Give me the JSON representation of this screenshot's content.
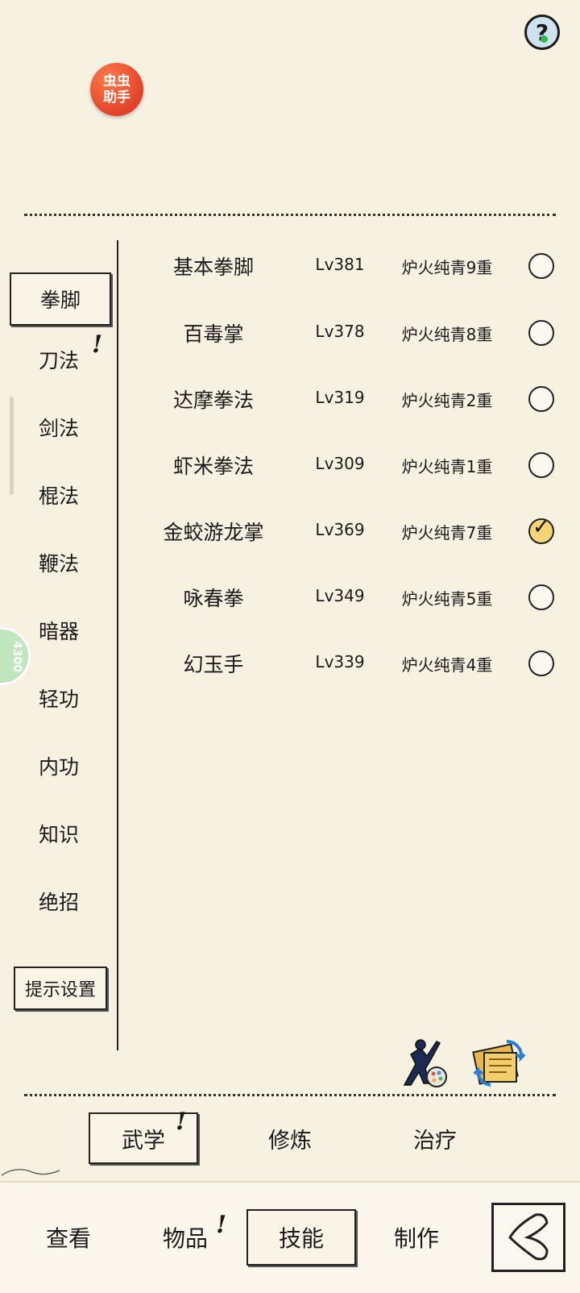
{
  "header": {
    "help_icon": "question-icon",
    "helper_badge": [
      "虫虫",
      "助手"
    ],
    "float_badge_text": "4300"
  },
  "categories": [
    {
      "label": "拳脚",
      "selected": true,
      "alert": false
    },
    {
      "label": "刀法",
      "selected": false,
      "alert": true
    },
    {
      "label": "剑法",
      "selected": false,
      "alert": false
    },
    {
      "label": "棍法",
      "selected": false,
      "alert": false
    },
    {
      "label": "鞭法",
      "selected": false,
      "alert": false
    },
    {
      "label": "暗器",
      "selected": false,
      "alert": false
    },
    {
      "label": "轻功",
      "selected": false,
      "alert": false
    },
    {
      "label": "内功",
      "selected": false,
      "alert": false
    },
    {
      "label": "知识",
      "selected": false,
      "alert": false
    },
    {
      "label": "绝招",
      "selected": false,
      "alert": false
    }
  ],
  "tip_settings_label": "提示设置",
  "skills": [
    {
      "name": "基本拳脚",
      "level": "Lv381",
      "realm": "炉火纯青9重",
      "equipped": false
    },
    {
      "name": "百毒掌",
      "level": "Lv378",
      "realm": "炉火纯青8重",
      "equipped": false
    },
    {
      "name": "达摩拳法",
      "level": "Lv319",
      "realm": "炉火纯青2重",
      "equipped": false
    },
    {
      "name": "虾米拳法",
      "level": "Lv309",
      "realm": "炉火纯青1重",
      "equipped": false
    },
    {
      "name": "金蛟游龙掌",
      "level": "Lv369",
      "realm": "炉火纯青7重",
      "equipped": true
    },
    {
      "name": "咏春拳",
      "level": "Lv349",
      "realm": "炉火纯青5重",
      "equipped": false
    },
    {
      "name": "幻玉手",
      "level": "Lv339",
      "realm": "炉火纯青4重",
      "equipped": false
    }
  ],
  "action_icons": [
    "martial-artist-icon",
    "scroll-swap-icon"
  ],
  "sub_tabs": [
    {
      "label": "武学",
      "selected": true,
      "alert": true
    },
    {
      "label": "修炼",
      "selected": false,
      "alert": false
    },
    {
      "label": "治疗",
      "selected": false,
      "alert": false
    }
  ],
  "bottom_tabs": [
    {
      "label": "查看",
      "selected": false,
      "alert": false
    },
    {
      "label": "物品",
      "selected": false,
      "alert": true
    },
    {
      "label": "技能",
      "selected": true,
      "alert": false
    },
    {
      "label": "制作",
      "selected": false,
      "alert": false
    }
  ],
  "alert_mark": "!",
  "check_mark": "✓",
  "help_mark": "?",
  "colors": {
    "background": "#f7f1e2",
    "helper_badge": "#e1432a",
    "check_fill": "#f5d478"
  }
}
